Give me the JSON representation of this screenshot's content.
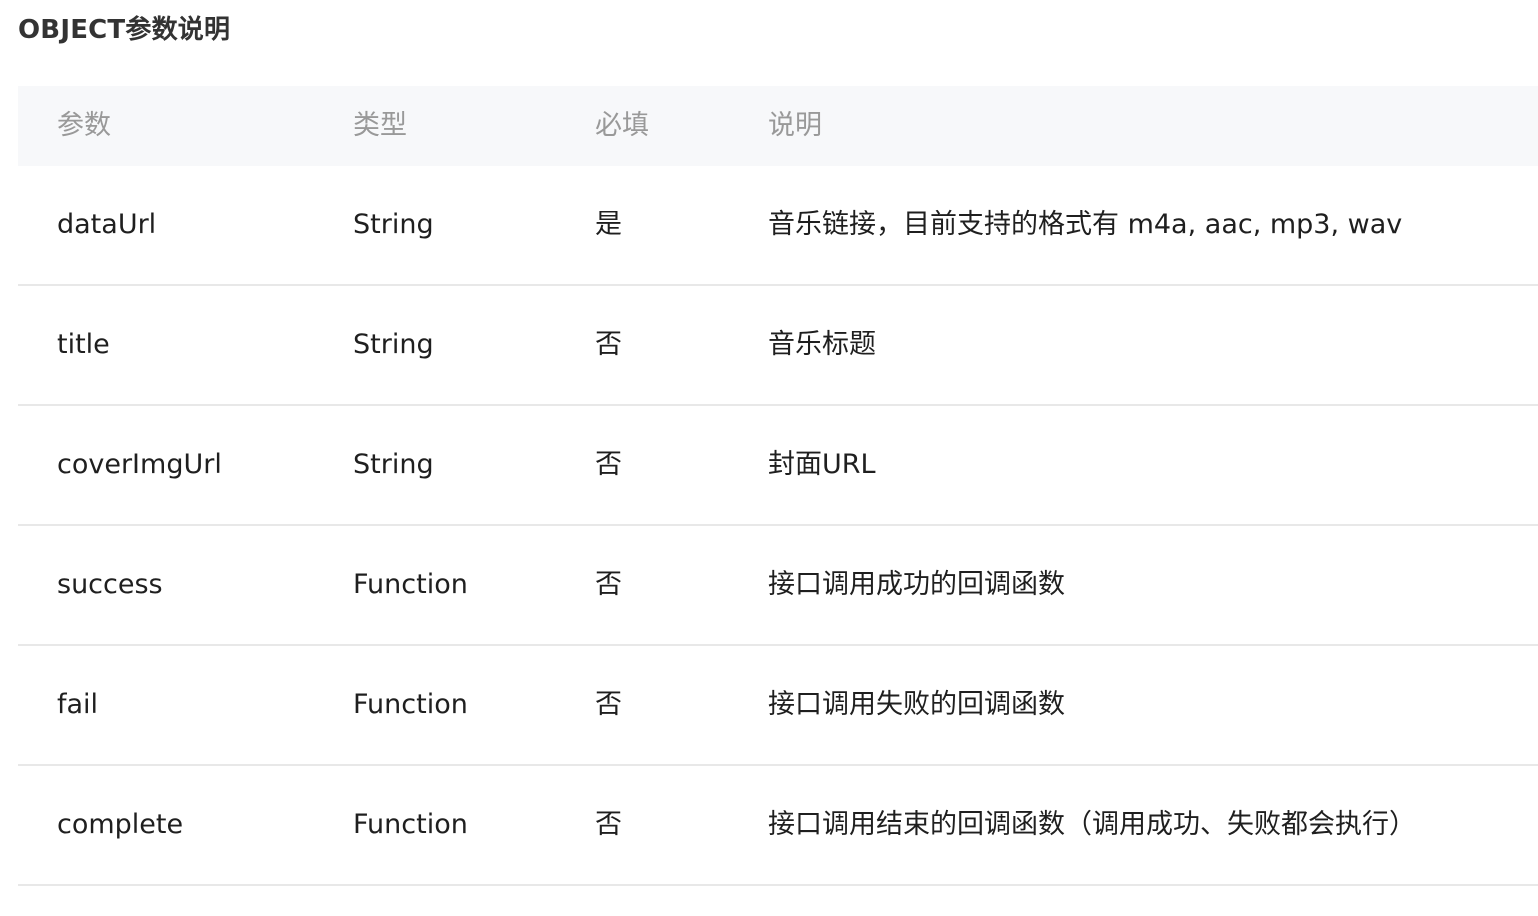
{
  "section_title": "OBJECT参数说明",
  "table": {
    "headers": {
      "name": "参数",
      "type": "类型",
      "required": "必填",
      "desc": "说明"
    },
    "rows": [
      {
        "name": "dataUrl",
        "type": "String",
        "required": "是",
        "desc": "音乐链接，目前支持的格式有 m4a, aac, mp3, wav"
      },
      {
        "name": "title",
        "type": "String",
        "required": "否",
        "desc": "音乐标题"
      },
      {
        "name": "coverImgUrl",
        "type": "String",
        "required": "否",
        "desc": "封面URL"
      },
      {
        "name": "success",
        "type": "Function",
        "required": "否",
        "desc": "接口调用成功的回调函数"
      },
      {
        "name": "fail",
        "type": "Function",
        "required": "否",
        "desc": "接口调用失败的回调函数"
      },
      {
        "name": "complete",
        "type": "Function",
        "required": "否",
        "desc": "接口调用结束的回调函数（调用成功、失败都会执行）"
      }
    ]
  }
}
